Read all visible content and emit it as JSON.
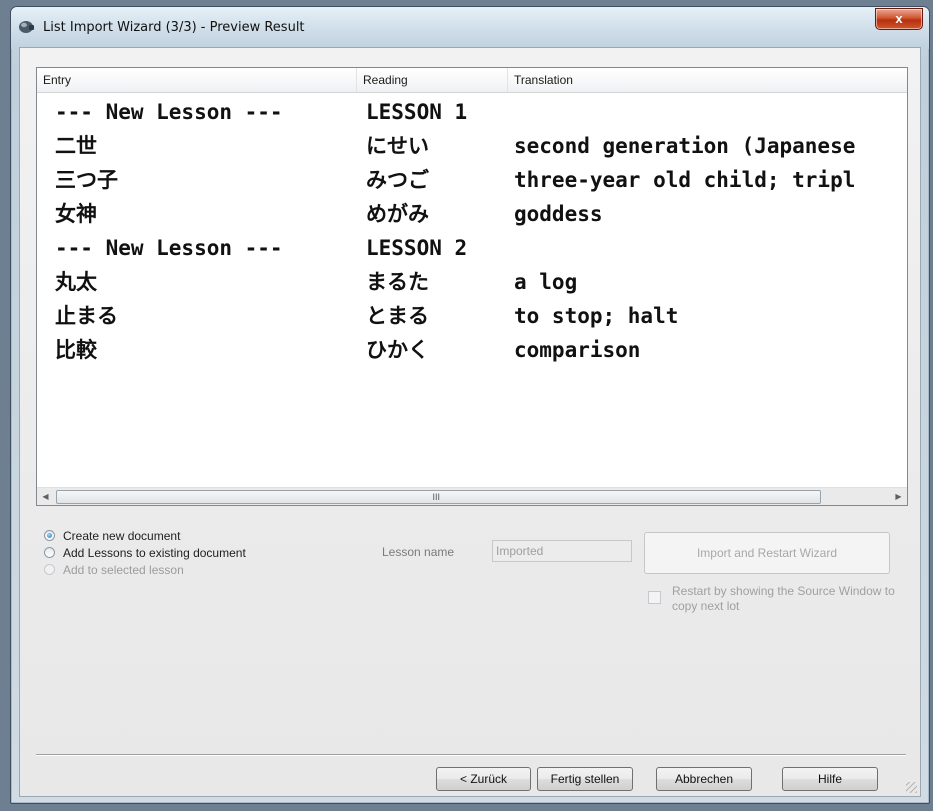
{
  "window": {
    "title": "List Import Wizard (3/3) - Preview Result",
    "close_label": "x",
    "app_icon": "app-icon"
  },
  "list": {
    "columns": [
      "Entry",
      "Reading",
      "Translation"
    ],
    "rows": [
      {
        "entry": "--- New Lesson ---",
        "reading": "LESSON 1",
        "translation": ""
      },
      {
        "entry": "二世",
        "reading": "にせい",
        "translation": "second generation (Japanese"
      },
      {
        "entry": "三つ子",
        "reading": "みつご",
        "translation": "three-year old child; tripl"
      },
      {
        "entry": "女神",
        "reading": "めがみ",
        "translation": "goddess"
      },
      {
        "entry": "--- New Lesson ---",
        "reading": "LESSON 2",
        "translation": ""
      },
      {
        "entry": "丸太",
        "reading": "まるた",
        "translation": "a log"
      },
      {
        "entry": "止まる",
        "reading": "とまる",
        "translation": "to stop; halt"
      },
      {
        "entry": "比較",
        "reading": "ひかく",
        "translation": "comparison"
      }
    ],
    "scroll_left": "◀",
    "scroll_right": "▶",
    "scroll_grip": "III"
  },
  "options": {
    "radios": [
      {
        "label": "Create new document",
        "checked": true,
        "enabled": true
      },
      {
        "label": "Add Lessons to existing document",
        "checked": false,
        "enabled": true
      },
      {
        "label": "Add to selected lesson",
        "checked": false,
        "enabled": false
      }
    ],
    "lesson_name_label": "Lesson name",
    "lesson_name_value": "Imported",
    "import_restart_label": "Import and Restart Wizard",
    "restart_checkbox_label": "Restart by showing the Source Window to copy next lot"
  },
  "footer": {
    "back_label": "< Zurück",
    "finish_label": "Fertig stellen",
    "cancel_label": "Abbrechen",
    "help_label": "Hilfe"
  }
}
